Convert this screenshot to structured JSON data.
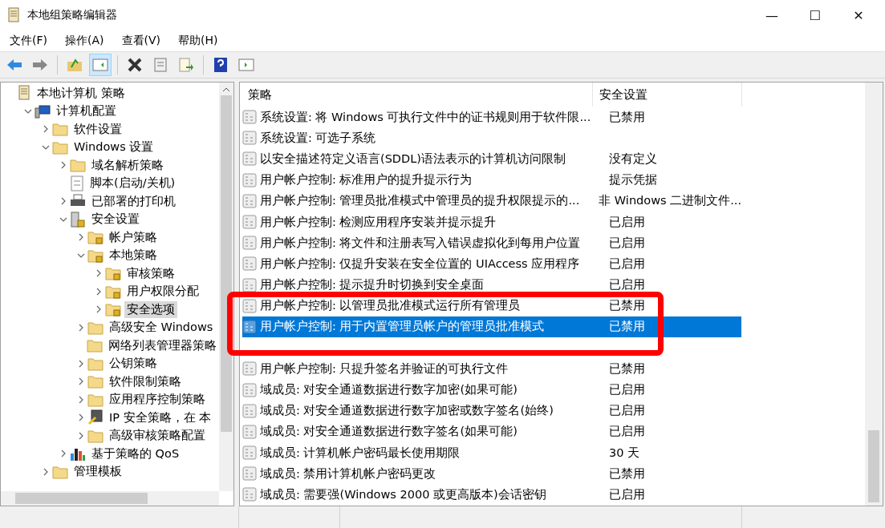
{
  "window": {
    "title": "本地组策略编辑器",
    "controls": [
      "—",
      "☐",
      "✕"
    ]
  },
  "menu": [
    "文件(F)",
    "操作(A)",
    "查看(V)",
    "帮助(H)"
  ],
  "toolbar": [
    {
      "kind": "back"
    },
    {
      "kind": "forward"
    },
    {
      "kind": "sep"
    },
    {
      "kind": "up"
    },
    {
      "kind": "pane",
      "selected": true
    },
    {
      "kind": "sep"
    },
    {
      "kind": "delete"
    },
    {
      "kind": "props"
    },
    {
      "kind": "export"
    },
    {
      "kind": "sep"
    },
    {
      "kind": "help"
    },
    {
      "kind": "pane2"
    }
  ],
  "tree": [
    {
      "label": "本地计算机 策略",
      "kind": "policy",
      "selected": false,
      "children": [
        {
          "label": "计算机配置",
          "kind": "computer",
          "expanded": true,
          "selected": false,
          "children": [
            {
              "label": "软件设置",
              "kind": "folder",
              "expanded": false,
              "selected": false
            },
            {
              "label": "Windows 设置",
              "kind": "folder",
              "expanded": true,
              "selected": false,
              "children": [
                {
                  "label": "域名解析策略",
                  "kind": "folder",
                  "expanded": false,
                  "selected": false
                },
                {
                  "label": "脚本(启动/关机)",
                  "kind": "script",
                  "selected": false
                },
                {
                  "label": "已部署的打印机",
                  "kind": "printer",
                  "expanded": false,
                  "selected": false
                },
                {
                  "label": "安全设置",
                  "kind": "secure",
                  "expanded": true,
                  "selected": false,
                  "children": [
                    {
                      "label": "帐户策略",
                      "kind": "lockfolder",
                      "expanded": false,
                      "selected": false
                    },
                    {
                      "label": "本地策略",
                      "kind": "lockfolder",
                      "expanded": true,
                      "selected": false,
                      "children": [
                        {
                          "label": "审核策略",
                          "kind": "lockfolder",
                          "expanded": false,
                          "selected": false
                        },
                        {
                          "label": "用户权限分配",
                          "kind": "lockfolder",
                          "expanded": false,
                          "selected": false
                        },
                        {
                          "label": "安全选项",
                          "kind": "lockfolder",
                          "expanded": false,
                          "selected": true
                        }
                      ]
                    },
                    {
                      "label": "高级安全 Windows",
                      "kind": "folder",
                      "expanded": false,
                      "selected": false
                    },
                    {
                      "label": "网络列表管理器策略",
                      "kind": "folder",
                      "selected": false
                    },
                    {
                      "label": "公钥策略",
                      "kind": "folder",
                      "expanded": false,
                      "selected": false
                    },
                    {
                      "label": "软件限制策略",
                      "kind": "folder",
                      "expanded": false,
                      "selected": false
                    },
                    {
                      "label": "应用程序控制策略",
                      "kind": "folder",
                      "expanded": false,
                      "selected": false
                    },
                    {
                      "label": "IP 安全策略，在 本",
                      "kind": "ip",
                      "expanded": false,
                      "selected": false
                    },
                    {
                      "label": "高级审核策略配置",
                      "kind": "folder",
                      "expanded": false,
                      "selected": false
                    }
                  ]
                },
                {
                  "label": "基于策略的 QoS",
                  "kind": "chart",
                  "expanded": false,
                  "selected": false
                }
              ]
            },
            {
              "label": "管理模板",
              "kind": "folder",
              "expanded": false,
              "selected": false
            }
          ]
        }
      ]
    }
  ],
  "table": {
    "columns": [
      "策略",
      "安全设置"
    ],
    "rows": [
      {
        "policy": "系统设置: 将 Windows 可执行文件中的证书规则用于软件限...",
        "setting": "已禁用",
        "selected": false
      },
      {
        "policy": "系统设置: 可选子系统",
        "selected": false
      },
      {
        "policy": "以安全描述符定义语言(SDDL)语法表示的计算机访问限制",
        "setting": "没有定义",
        "selected": false
      },
      {
        "policy": "用户帐户控制: 标准用户的提升提示行为",
        "setting": "提示凭据",
        "selected": false
      },
      {
        "policy": "用户帐户控制: 管理员批准模式中管理员的提升权限提示的...",
        "setting": "非 Windows 二进制文件...",
        "selected": false
      },
      {
        "policy": "用户帐户控制: 检测应用程序安装并提示提升",
        "setting": "已启用",
        "selected": false
      },
      {
        "policy": "用户帐户控制: 将文件和注册表写入错误虚拟化到每用户位置",
        "setting": "已启用",
        "selected": false
      },
      {
        "policy": "用户帐户控制: 仅提升安装在安全位置的 UIAccess 应用程序",
        "setting": "已启用",
        "selected": false
      },
      {
        "policy": "用户帐户控制: 提示提升时切换到安全桌面",
        "setting": "已启用",
        "selected": false
      },
      {
        "policy": "用户帐户控制: 以管理员批准模式运行所有管理员",
        "setting": "已禁用",
        "selected": false
      },
      {
        "policy": "用户帐户控制: 用于内置管理员帐户的管理员批准模式",
        "setting": "已禁用",
        "selected": true
      },
      {
        "kind": "obscured",
        "selected": false
      },
      {
        "policy": "用户帐户控制: 只提升签名并验证的可执行文件",
        "setting": "已禁用",
        "selected": false
      },
      {
        "policy": "域成员: 对安全通道数据进行数字加密(如果可能)",
        "setting": "已启用",
        "selected": false
      },
      {
        "policy": "域成员: 对安全通道数据进行数字加密或数字签名(始终)",
        "setting": "已启用",
        "selected": false
      },
      {
        "policy": "域成员: 对安全通道数据进行数字签名(如果可能)",
        "setting": "已启用",
        "selected": false
      },
      {
        "policy": "域成员: 计算机帐户密码最长使用期限",
        "setting": "30 天",
        "selected": false
      },
      {
        "policy": "域成员: 禁用计算机帐户密码更改",
        "setting": "已禁用",
        "selected": false
      },
      {
        "policy": "域成员: 需要强(Windows 2000 或更高版本)会话密钥",
        "setting": "已启用",
        "selected": false
      }
    ]
  },
  "annotation": {
    "kind": "highlight-box",
    "color": "#ff0000"
  }
}
